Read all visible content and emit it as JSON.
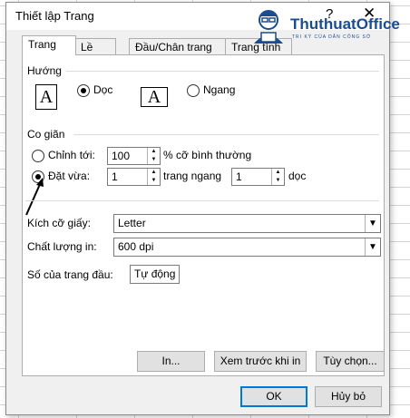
{
  "dialog": {
    "title": "Thiết lập Trang",
    "help": "?",
    "close": "✕"
  },
  "tabs": [
    {
      "label": "Trang"
    },
    {
      "label": "Lề"
    },
    {
      "label": "Đầu/Chân trang"
    },
    {
      "label": "Trang tính"
    }
  ],
  "orientation": {
    "heading": "Hướng",
    "portrait_label": "Dọc",
    "landscape_label": "Ngang",
    "icon_letter": "A",
    "selected": "portrait"
  },
  "scaling": {
    "heading": "Co giãn",
    "adjust_label": "Chỉnh tới:",
    "adjust_value": "100",
    "adjust_suffix": "% cỡ bình thường",
    "fit_label": "Đặt vừa:",
    "fit_wide_value": "1",
    "fit_wide_suffix": "trang ngang",
    "fit_tall_value": "1",
    "fit_tall_suffix": "dọc",
    "selected": "fit"
  },
  "paper_size": {
    "label": "Kích cỡ giấy:",
    "value": "Letter"
  },
  "print_quality": {
    "label": "Chất lượng in:",
    "value": "600 dpi"
  },
  "first_page": {
    "label": "Số của trang đầu:",
    "value": "Tự động"
  },
  "buttons": {
    "print": "In...",
    "preview": "Xem trước khi in",
    "options": "Tùy chọn...",
    "ok": "OK",
    "cancel": "Hủy bỏ"
  },
  "logo": {
    "name": "ThuthuatOffice",
    "tagline": "TRI KỲ CỦA DÂN CÔNG SỞ"
  }
}
